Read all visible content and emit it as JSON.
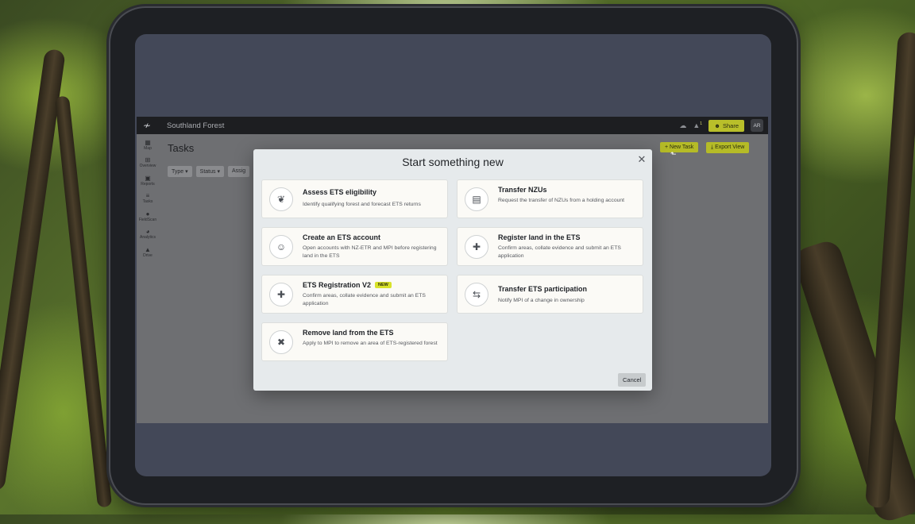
{
  "app": {
    "title": "Southland Forest",
    "share_label": "Share",
    "avatar_initials": "AR",
    "notification_count": "1"
  },
  "sidebar": {
    "items": [
      {
        "label": "Map",
        "icon": "map-icon"
      },
      {
        "label": "Overview",
        "icon": "grid-icon"
      },
      {
        "label": "Reports",
        "icon": "document-icon"
      },
      {
        "label": "Tasks",
        "icon": "list-icon"
      },
      {
        "label": "FieldScan",
        "icon": "camera-icon"
      },
      {
        "label": "Analytics",
        "icon": "chart-icon"
      },
      {
        "label": "Drive",
        "icon": "drive-icon"
      }
    ]
  },
  "page": {
    "title": "Tasks",
    "filters": [
      "Type",
      "Status",
      "Assig"
    ],
    "new_task_label": "New Task",
    "export_view_label": "Export View"
  },
  "modal": {
    "title": "Start something new",
    "cancel_label": "Cancel",
    "cards": [
      {
        "title": "Assess ETS eligibility",
        "description": "Identify qualifying forest and forecast ETS returns",
        "icon": "leaf-icon"
      },
      {
        "title": "Transfer NZUs",
        "description": "Request the transfer of NZUs from a holding account",
        "icon": "money-icon"
      },
      {
        "title": "Create an ETS account",
        "description": "Open accounts with NZ-ETR and MPI before registering land in the ETS",
        "icon": "user-edit-icon"
      },
      {
        "title": "Register land in the ETS",
        "description": "Confirm areas, collate evidence and submit an ETS application",
        "icon": "file-plus-icon"
      },
      {
        "title": "ETS Registration V2",
        "badge": "NEW",
        "description": "Confirm areas, collate evidence and submit an ETS application",
        "icon": "file-plus-icon"
      },
      {
        "title": "Transfer ETS participation",
        "description": "Notify MPI of a change in ownership",
        "icon": "arrows-swap-icon"
      },
      {
        "title": "Remove land from the ETS",
        "description": "Apply to MPI to remove an area of ETS-registered forest",
        "icon": "file-x-icon"
      }
    ]
  }
}
